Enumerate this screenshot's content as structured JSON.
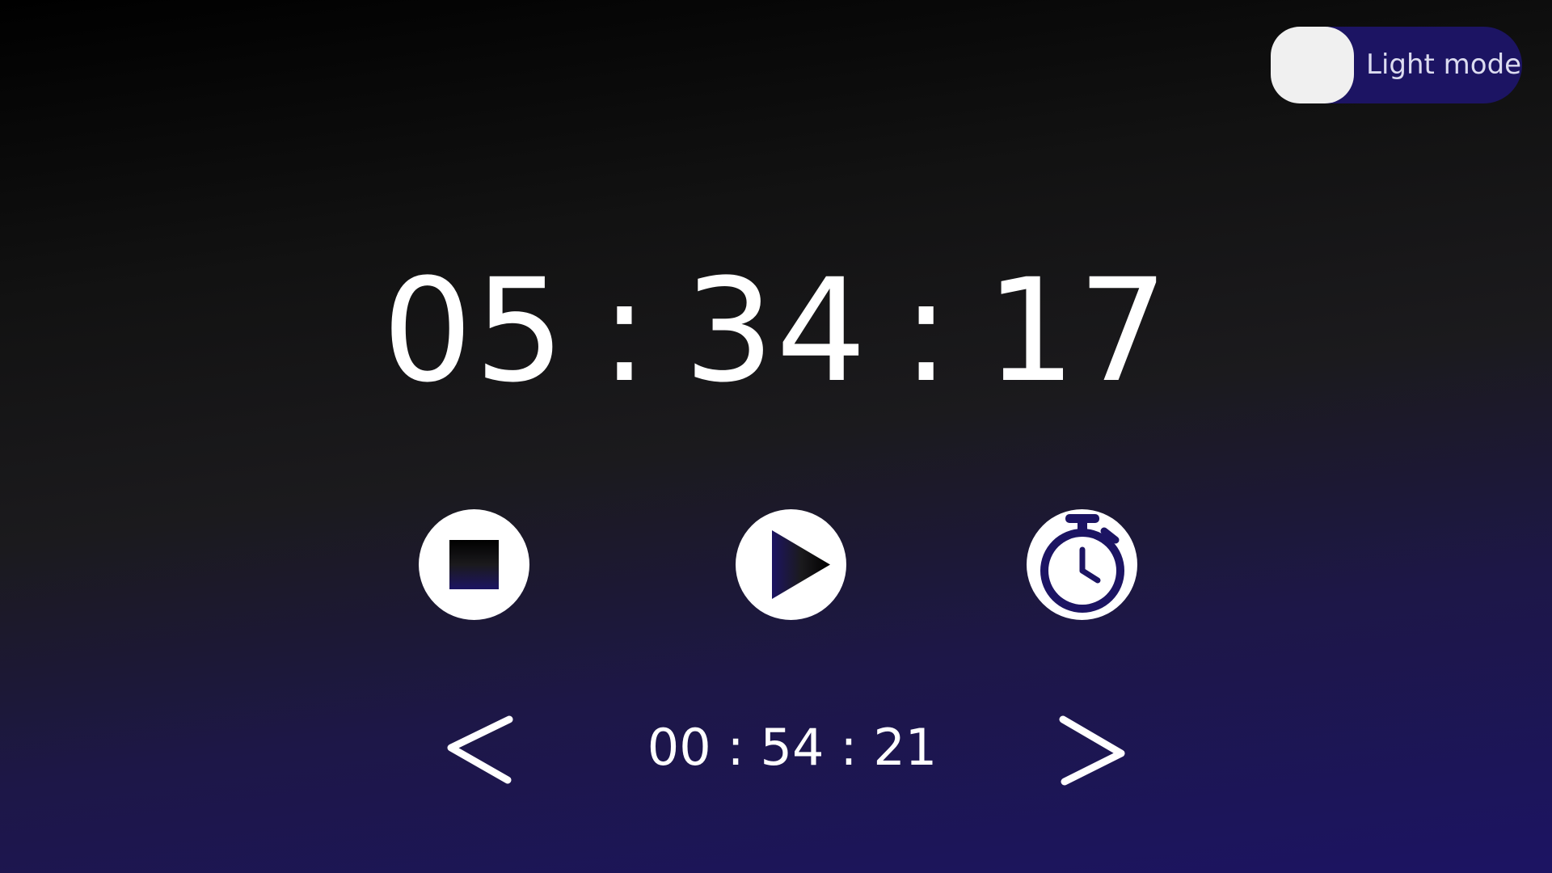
{
  "theme_toggle": {
    "label": "Light mode"
  },
  "main_time": {
    "hours": "05",
    "minutes": "34",
    "seconds": "17",
    "separator": ":"
  },
  "controls": {
    "stop_icon": "stop-icon",
    "play_icon": "play-icon",
    "timer_icon": "stopwatch-icon"
  },
  "lap": {
    "hours": "00",
    "minutes": "54",
    "seconds": "21",
    "separator": ":",
    "prev_icon": "chevron-left-icon",
    "next_icon": "chevron-right-icon"
  },
  "colors": {
    "accent": "#1c1463",
    "background_top": "#000000",
    "background_mid": "#1b1a1d",
    "foreground": "#ffffff",
    "toggle_knob": "#f0f0f0"
  }
}
